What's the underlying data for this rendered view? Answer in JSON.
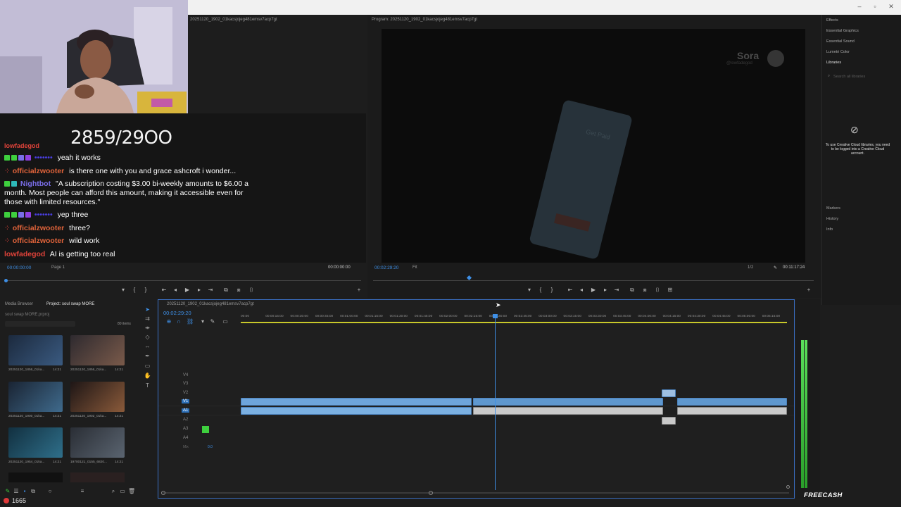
{
  "window": {
    "minimize_label": "–",
    "maximize_label": "▫",
    "close_label": "✕"
  },
  "stream": {
    "counter": "2859/29OO",
    "viewer_count": "1665",
    "sponsor": "FREECASH",
    "chat": [
      {
        "user": "lowfadegod",
        "user_color": "#e0433a",
        "text": "",
        "partial": true
      },
      {
        "user": "•••••••",
        "user_color": "#4a3fe0",
        "text": "yeah it works"
      },
      {
        "user": "officialzwooter",
        "user_color": "#e0633a",
        "text": "is there one with you and grace ashcroft i wonder..."
      },
      {
        "user": "Nightbot",
        "user_color": "#7a6ee8",
        "text": "\"A subscription costing $3.00 bi-weekly amounts to $6.00 a month. Most people can afford this amount, making it accessible even for those with limited resources.\""
      },
      {
        "user": "•••••••",
        "user_color": "#4a3fe0",
        "text": "yep three"
      },
      {
        "user": "officialzwooter",
        "user_color": "#e0633a",
        "text": "three?"
      },
      {
        "user": "officialzwooter",
        "user_color": "#e0633a",
        "text": "wild work"
      },
      {
        "user": "lowfadegod",
        "user_color": "#e0433a",
        "text": "AI is getting too real"
      }
    ]
  },
  "source_monitor": {
    "title": "20251120_1902_01kacsjojeg481emsv7acp7gt",
    "timecode_in": "00:00:00:00",
    "page": "Page 1",
    "timecode_out": "00:00:00:00"
  },
  "program_monitor": {
    "title": "Program: 20251120_1902_01kacsjojeg481emsv7acp7gt",
    "timecode": "00:02:29:20",
    "fit": "Fit",
    "resolution": "1/2",
    "duration": "00:11:17:24",
    "watermark_name": "Sora",
    "watermark_handle": "@lowfadegod",
    "phone_text": "Get Paid"
  },
  "right_panel": {
    "items": [
      "Effects",
      "Essential Graphics",
      "Essential Sound",
      "Lumetri Color",
      "Libraries"
    ],
    "search_placeholder": "Search all libraries",
    "cc_message": "To use Creative Cloud libraries, you need to be logged into a Creative Cloud account.",
    "lower_items": [
      "Markers",
      "History",
      "Info"
    ]
  },
  "project_panel": {
    "tabs": [
      "Media Browser",
      "Project: soul swap MORE"
    ],
    "project_file": "soul swap MORE.prproj",
    "item_count": "80 items",
    "thumbnails": [
      {
        "label": "20251120_1856_01ka...",
        "dur": "14:21"
      },
      {
        "label": "20251120_1856_01ka...",
        "dur": "14:21"
      },
      {
        "label": "20251120_1900_01ka...",
        "dur": "14:21"
      },
      {
        "label": "20251120_1902_01ka...",
        "dur": "14:21"
      },
      {
        "label": "20251120_1954_01ka...",
        "dur": "14:21"
      },
      {
        "label": "19700121_0155_6820...",
        "dur": "14:21"
      }
    ]
  },
  "timeline": {
    "sequence_name": "20251120_1902_01kacsjojeg481emsv7acp7gt",
    "timecode": "00:02:29:20",
    "ruler": [
      "00:00",
      "00:00:15:00",
      "00:00:30:00",
      "00:00:45:00",
      "00:01:00:00",
      "00:01:15:00",
      "00:01:30:00",
      "00:01:45:00",
      "00:02:00:00",
      "00:02:15:00",
      "00:02:30:00",
      "00:02:45:00",
      "00:03:00:00",
      "00:03:15:00",
      "00:03:30:00",
      "00:03:45:00",
      "00:04:00:00",
      "00:04:15:00",
      "00:04:30:00",
      "00:04:45:00",
      "00:05:00:00",
      "00:05:15:00"
    ],
    "video_tracks": [
      "V4",
      "V3",
      "V2",
      "V1"
    ],
    "audio_tracks": [
      "A1",
      "A2",
      "A3",
      "A4"
    ],
    "mix_label": "Mix",
    "mix_value": "0.0"
  },
  "colors": {
    "accent": "#3e8fe6",
    "clip_blue": "#6ea5dc",
    "meter_green": "#3ecf3e"
  }
}
